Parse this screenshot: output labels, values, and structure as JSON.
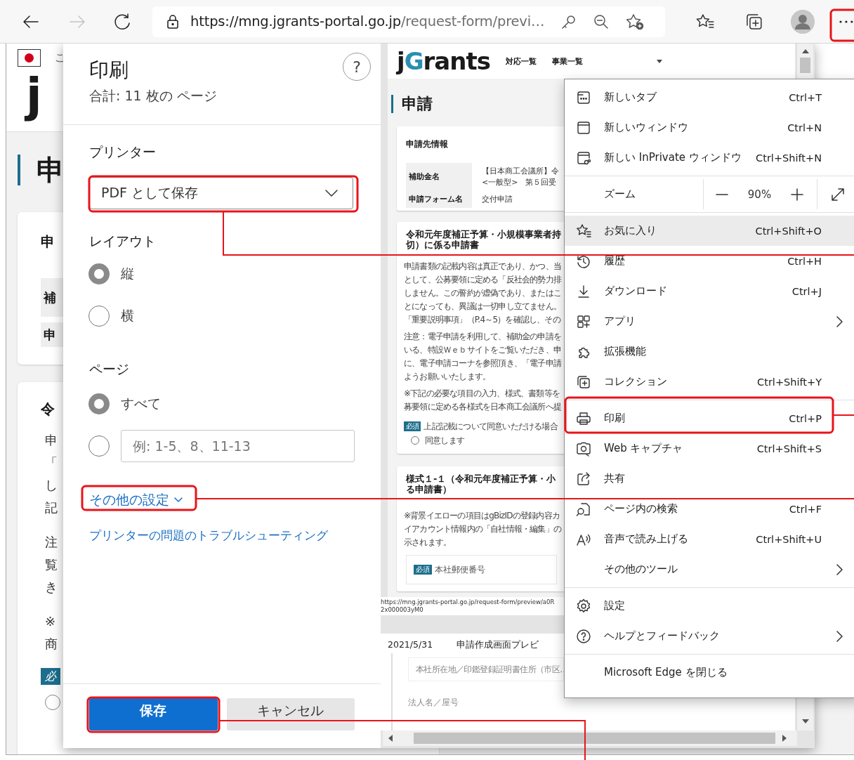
{
  "toolbar": {
    "nav_buttons": [
      {
        "kind": "back",
        "disabled": false
      },
      {
        "kind": "forward",
        "disabled": true
      },
      {
        "kind": "refresh",
        "disabled": false
      }
    ],
    "url_host": "https://mng.jgrants-portal.go.jp",
    "url_path": "/request-form/previ…"
  },
  "background_page": {
    "flag_caption": "こ",
    "logo": "j",
    "heading": "申",
    "card_title": "申",
    "rows": [
      "補",
      "申"
    ],
    "card2_title": "令",
    "line_groups": [
      [
        "申",
        "「",
        "し",
        "記"
      ],
      [
        "注",
        "覧",
        "き"
      ],
      [
        "※",
        "商"
      ]
    ],
    "badge": "必",
    "radio": {
      "selected": false
    }
  },
  "print_dialog": {
    "title": "印刷",
    "page_count": "合計: 11 枚の ページ",
    "help": "?",
    "printer_label": "プリンター",
    "printer": "PDF として保存",
    "layout_label": "レイアウト",
    "layout_options": [
      {
        "label": "縦",
        "selected": true
      },
      {
        "label": "横",
        "selected": false
      }
    ],
    "pages_label": "ページ",
    "pages_options": [
      {
        "kind": "all",
        "label": "すべて",
        "selected": true
      },
      {
        "kind": "range",
        "placeholder": "例: 1-5、8、11-13",
        "selected": false
      }
    ],
    "more_settings": "その他の設定",
    "troubleshoot": "プリンターの問題のトラブルシューティング",
    "save": "保存",
    "cancel": "キャンセル"
  },
  "preview": {
    "logo": "jGrants",
    "nav": [
      "対応一覧",
      "事業一覧"
    ],
    "heading": "申請",
    "info_card": {
      "title": "申請先情報",
      "rows": [
        {
          "label": "補助金名",
          "value_lines": [
            "【日本商工会議所】令",
            "<一般型>　第５回受"
          ]
        },
        {
          "label": "申請フォーム名",
          "value_lines": [
            "交付申請"
          ]
        }
      ]
    },
    "cards": [
      {
        "title_lines": [
          "令和元年度補正予算・小規模事業者持",
          "切）に係る申請書"
        ],
        "blocks": [
          {
            "kind": "paragraph",
            "lines": [
              "申請書類の記載内容は真正であり、かつ、当",
              "として、公募要領に定める「反社会的勢力排",
              "しません。この誓約が虚偽であり、またはこ",
              "とになっても、異議は一切申し立てません。",
              "「重要説明事項」（P.4～5）を確認し、その"
            ]
          },
          {
            "kind": "paragraph",
            "lines": [
              "注意：電子申請を利用して、補助金の申請を",
              "いる、特設Ｗｅｂサイトをご覧いただき、申",
              "に、電子申請コーナを参照頂き、「電子申請",
              "ようお願いいたします。"
            ]
          },
          {
            "kind": "paragraph",
            "lines": [
              "※下記の必要な項目の入力、様式、書類等を",
              "募要領に定める各様式を日本商工会議所へ提"
            ]
          },
          {
            "kind": "consent",
            "badge": "必須",
            "label": "上記記載について同意いただける場合",
            "option": "同意します",
            "selected": false
          }
        ]
      },
      {
        "title_lines": [
          "様式１-１（令和元年度補正予算・小",
          "る申請書）"
        ],
        "blocks": [
          {
            "kind": "paragraph",
            "lines": [
              "※背景イエローの項目はgBizIDの登録内容カ",
              "イアカウント情報内の「自社情報・編集」の",
              "示されます。"
            ]
          },
          {
            "kind": "field",
            "badge": "必須",
            "label": "本社郵便番号"
          }
        ]
      }
    ],
    "footer_url": "https://mng.jgrants-portal.go.jp/request-form/preview/a0R2x000003yM0",
    "page2_date": "2021/5/31",
    "page2_title": "申請作成画面プレビ",
    "page2_field": "本社所在地／印鑑登録証明書住所（市区…",
    "page2_label": "法人名／屋号"
  },
  "menu": {
    "items": [
      {
        "kind": "item",
        "label": "新しいタブ",
        "shortcut": "Ctrl+T",
        "submenu": false,
        "highlighted": false
      },
      {
        "kind": "item",
        "label": "新しいウィンドウ",
        "shortcut": "Ctrl+N",
        "submenu": false,
        "highlighted": false
      },
      {
        "kind": "item",
        "label": "新しい InPrivate ウィンドウ",
        "shortcut": "Ctrl+Shift+N",
        "submenu": false,
        "highlighted": false
      },
      {
        "kind": "divider"
      },
      {
        "kind": "zoom",
        "label": "ズーム",
        "value": "90%"
      },
      {
        "kind": "divider"
      },
      {
        "kind": "item",
        "label": "お気に入り",
        "shortcut": "Ctrl+Shift+O",
        "submenu": false,
        "highlighted": true
      },
      {
        "kind": "item",
        "label": "履歴",
        "shortcut": "Ctrl+H",
        "submenu": false,
        "highlighted": false
      },
      {
        "kind": "item",
        "label": "ダウンロード",
        "shortcut": "Ctrl+J",
        "submenu": false,
        "highlighted": false
      },
      {
        "kind": "item",
        "label": "アプリ",
        "submenu": true,
        "highlighted": false
      },
      {
        "kind": "item",
        "label": "拡張機能",
        "submenu": false,
        "highlighted": false
      },
      {
        "kind": "item",
        "label": "コレクション",
        "shortcut": "Ctrl+Shift+Y",
        "submenu": false,
        "highlighted": false
      },
      {
        "kind": "divider"
      },
      {
        "kind": "item",
        "label": "印刷",
        "shortcut": "Ctrl+P",
        "submenu": false,
        "highlighted": false
      },
      {
        "kind": "item",
        "label": "Web キャプチャ",
        "shortcut": "Ctrl+Shift+S",
        "submenu": false,
        "highlighted": false
      },
      {
        "kind": "item",
        "label": "共有",
        "submenu": false,
        "highlighted": false
      },
      {
        "kind": "item",
        "label": "ページ内の検索",
        "shortcut": "Ctrl+F",
        "submenu": false,
        "highlighted": false
      },
      {
        "kind": "item",
        "label": "音声で読み上げる",
        "shortcut": "Ctrl+Shift+U",
        "submenu": false,
        "highlighted": false
      },
      {
        "kind": "item",
        "label": "その他のツール",
        "submenu": true,
        "highlighted": false
      },
      {
        "kind": "divider"
      },
      {
        "kind": "item",
        "label": "設定",
        "submenu": false,
        "highlighted": false
      },
      {
        "kind": "item",
        "label": "ヘルプとフィードバック",
        "submenu": true,
        "highlighted": false
      },
      {
        "kind": "divider"
      },
      {
        "kind": "item",
        "label": "Microsoft Edge を閉じる",
        "submenu": false,
        "highlighted": false
      }
    ]
  }
}
